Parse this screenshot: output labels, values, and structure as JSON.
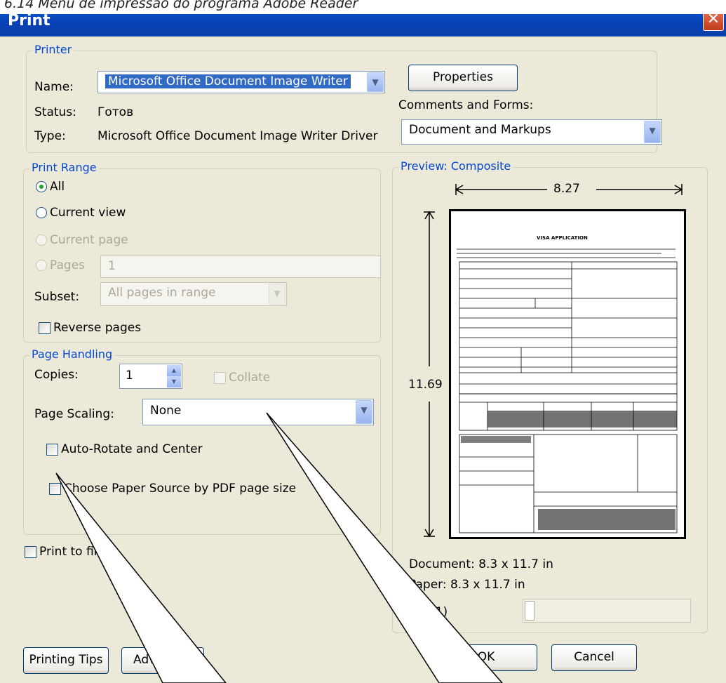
{
  "caption": "6.14 Menu de impressão do programa Adobe Reader",
  "window": {
    "title": "Print",
    "close_glyph": "✕"
  },
  "printer": {
    "group_title": "Printer",
    "name_label": "Name:",
    "name_value": "Microsoft Office Document Image Writer",
    "status_label": "Status:",
    "status_value": "Готов",
    "type_label": "Type:",
    "type_value": "Microsoft Office Document Image Writer Driver",
    "properties_button": "Properties",
    "comments_label": "Comments and Forms:",
    "comments_value": "Document and Markups"
  },
  "print_range": {
    "group_title": "Print Range",
    "all": "All",
    "current_view": "Current view",
    "current_page": "Current page",
    "pages": "Pages",
    "pages_value": "1",
    "subset_label": "Subset:",
    "subset_value": "All pages in range",
    "reverse_pages": "Reverse pages",
    "selected": "all"
  },
  "page_handling": {
    "group_title": "Page Handling",
    "copies_label": "Copies:",
    "copies_value": "1",
    "collate": "Collate",
    "scaling_label": "Page Scaling:",
    "scaling_value": "None",
    "auto_rotate": "Auto-Rotate and Center",
    "paper_source": "Choose Paper Source by PDF page size"
  },
  "print_to_file": "Print to file",
  "preview": {
    "group_title": "Preview: Composite",
    "width_value": "8.27",
    "height_value": "11.69",
    "page_heading": "VISA APPLICATION",
    "document_size": "Document: 8.3 x 11.7 in",
    "paper_size": "Paper: 8.3 x 11.7 in",
    "page_indicator": "(1)"
  },
  "buttons": {
    "printing_tips": "Printing Tips",
    "advanced": "Advanced",
    "ok": "OK",
    "cancel": "Cancel"
  },
  "colors": {
    "titlebar": "#0842b8",
    "group_title": "#0046d5",
    "selection": "#316ac5",
    "dialog_bg": "#ece9d8"
  }
}
